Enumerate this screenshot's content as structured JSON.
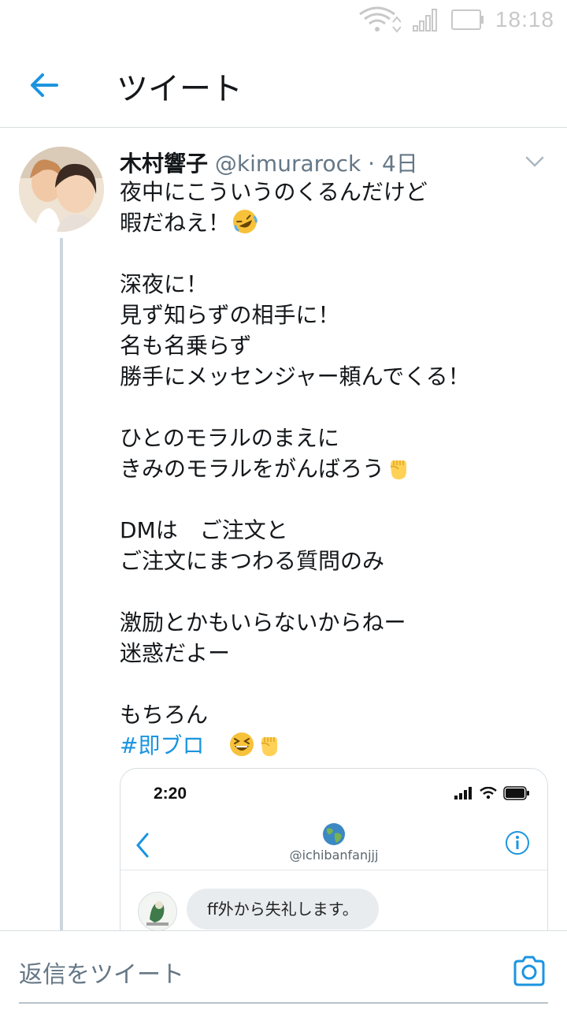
{
  "status_bar": {
    "time": "18:18"
  },
  "header": {
    "title": "ツイート"
  },
  "tweet": {
    "author_name": "木村響子",
    "handle": "@kimurarock",
    "separator": " · ",
    "age": "4日",
    "lines": [
      "夜中にこういうのくるんだけど",
      "暇だねえ！",
      "",
      "深夜に！",
      "見ず知らずの相手に！",
      "名も名乗らず",
      "勝手にメッセンジャー頼んでくる！",
      "",
      "ひとのモラルのまえに",
      "きみのモラルをがんばろう",
      "",
      "DMは　ご注文と",
      "ご注文にまつわる質問のみ",
      "",
      "激励とかもいらないからねー",
      "迷惑だよー",
      "",
      "もちろん"
    ],
    "hashtag": "#即ブロ",
    "emojis": [
      "rolling-on-floor-laughing",
      "raised-fist",
      "grinning-squinting-face"
    ]
  },
  "media": {
    "time": "2:20",
    "dm_handle": "@ichibanfanjjj",
    "message": "ff外から失礼します。"
  },
  "reply": {
    "placeholder": "返信をツイート"
  }
}
